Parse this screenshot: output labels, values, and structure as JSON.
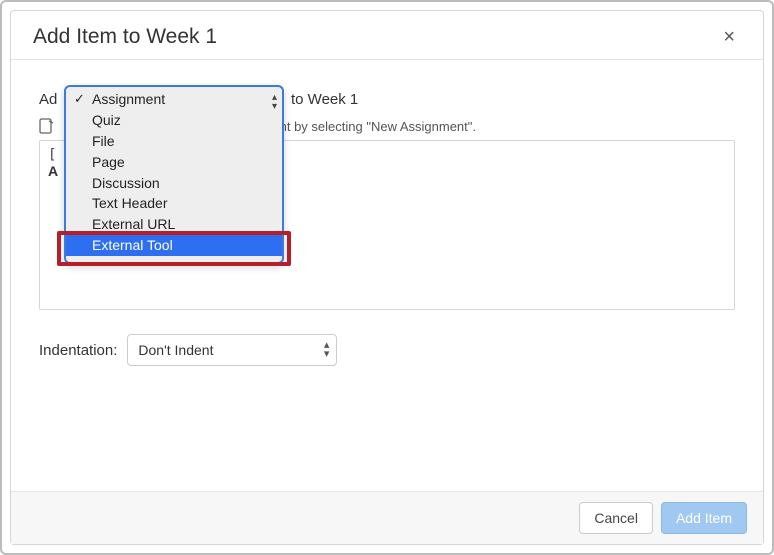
{
  "header": {
    "title": "Add Item to Week 1"
  },
  "addRow": {
    "prefix": "Ad",
    "suffix": "to Week 1"
  },
  "dropdown": {
    "options": [
      {
        "label": "Assignment",
        "checked": true,
        "highlight": false
      },
      {
        "label": "Quiz",
        "checked": false,
        "highlight": false
      },
      {
        "label": "File",
        "checked": false,
        "highlight": false
      },
      {
        "label": "Page",
        "checked": false,
        "highlight": false
      },
      {
        "label": "Discussion",
        "checked": false,
        "highlight": false
      },
      {
        "label": "Text Header",
        "checked": false,
        "highlight": false
      },
      {
        "label": "External URL",
        "checked": false,
        "highlight": false
      },
      {
        "label": "External Tool",
        "checked": false,
        "highlight": true
      }
    ]
  },
  "instruction": "with this module, or add an assignment by selecting \"New Assignment\".",
  "list": {
    "visibleRow1": "[",
    "visibleRow2": "A"
  },
  "indent": {
    "label": "Indentation:",
    "value": "Don't Indent"
  },
  "footer": {
    "cancel": "Cancel",
    "add": "Add Item"
  }
}
